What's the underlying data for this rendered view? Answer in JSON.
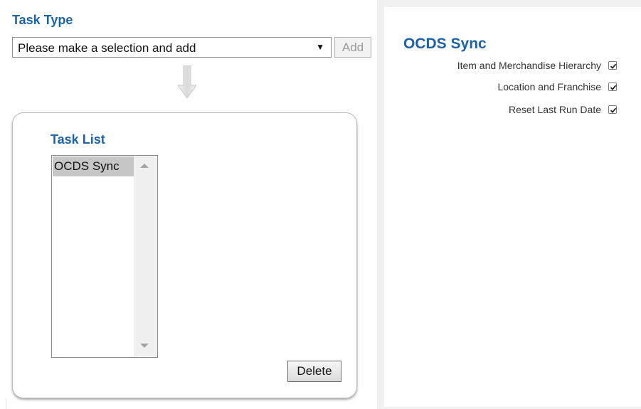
{
  "task_type": {
    "title": "Task Type",
    "select_value": "Please make a selection and add",
    "add_label": "Add"
  },
  "task_list": {
    "title": "Task List",
    "items": [
      "OCDS Sync"
    ],
    "delete_label": "Delete"
  },
  "ocds_sync": {
    "title": "OCDS Sync",
    "options": [
      {
        "label": "Item and Merchandise Hierarchy",
        "checked": true
      },
      {
        "label": "Location and Franchise",
        "checked": true
      },
      {
        "label": "Reset Last Run Date",
        "checked": true
      }
    ]
  },
  "colors": {
    "title_blue": "#1e63a8",
    "panel_gray": "#f1f1f1",
    "selected_item": "#c6c6c6"
  }
}
